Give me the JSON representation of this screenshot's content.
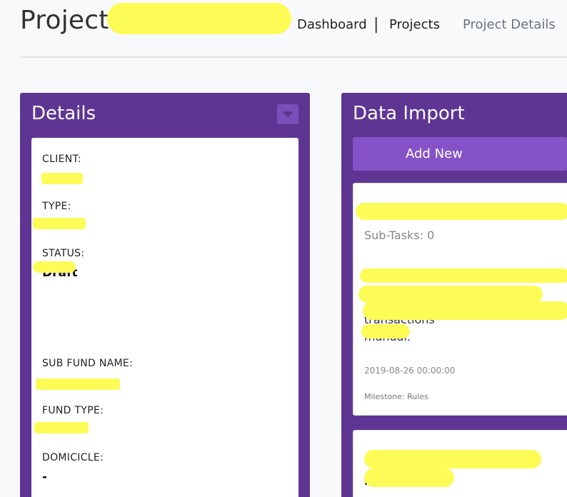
{
  "header": {
    "title": "Project:",
    "nav": {
      "dashboard": "Dashboard",
      "separator": "|",
      "projects": "Projects",
      "current": "Project Details"
    }
  },
  "details": {
    "title": "Details",
    "fields": {
      "client_label": "CLIENT:",
      "type_label": "TYPE:",
      "status_label": "STATUS:",
      "status_value": "Draft",
      "sub_fund_label": "SUB FUND NAME:",
      "fund_type_label": "FUND TYPE:",
      "domicile_label": "DOMICICLE:",
      "domicile_value": "-"
    }
  },
  "data_import": {
    "title": "Data Import",
    "add_new_label": "Add New",
    "card1": {
      "subtasks": "Sub-Tasks: 0",
      "desc_fragment": "transactions",
      "desc_end": "manual.",
      "date": "2019-08-26 00:00:00",
      "milestone": "Milestone: Rules"
    },
    "card2": {
      "fragment": "instrument"
    }
  },
  "colors": {
    "panel": "#5f3594",
    "button": "#8553c7",
    "redaction": "#fdfb56"
  }
}
